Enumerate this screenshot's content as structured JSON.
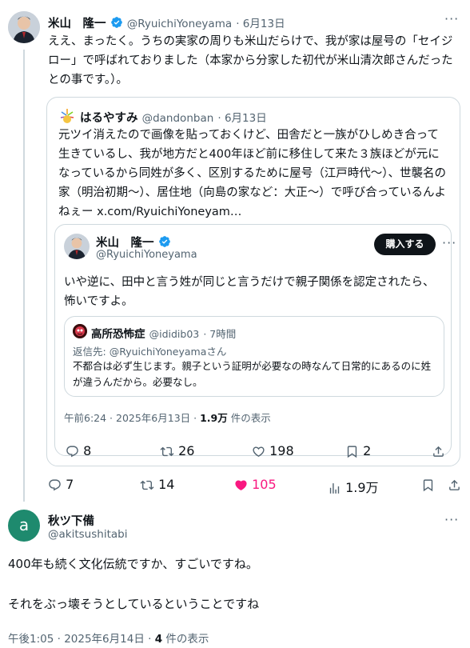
{
  "tweet1": {
    "name": "米山　隆一",
    "handle": "@RyuichiYoneyama",
    "date": "· 6月13日",
    "text": "ええ、まったく。うちの実家の周りも米山だらけで、我が家は屋号の「セイジロー」で呼ばれておりました（本家から分家した初代が米山清次郎さんだったとの事です。）。",
    "replies": "7",
    "reposts": "14",
    "likes": "105",
    "views": "1.9万"
  },
  "quote1": {
    "name": "はるやすみ",
    "handle": "@dandonban",
    "date": "· 6月13日",
    "text": "元ツイ消えたので画像を貼っておくけど、田舎だと一族がひしめき合って生きているし、我が地方だと400年ほど前に移住して来た３族ほどが元になっているから同姓が多く、区別するために屋号（江戸時代～）、世襲名の家（明治初期～）、居住地（向島の家など：大正～）で呼び合っているんよねぇー ",
    "link": "x.com/RyuichiYoneyam…"
  },
  "quote2": {
    "name": "米山　隆一",
    "handle": "@RyuichiYoneyama",
    "buy_label": "購入する",
    "text": "いや逆に、田中と言う姓が同じと言うだけで親子関係を認定されたら、怖いですよ。",
    "timestamp": "午前6:24 · 2025年6月13日 · ",
    "views_count": "1.9万",
    "views_label": " 件の表示",
    "replies": "8",
    "reposts": "26",
    "likes": "198",
    "bookmarks": "2"
  },
  "quote3": {
    "name": "高所恐怖症",
    "handle": "@ididib03",
    "date": "· 7時間",
    "reply_to_prefix": "返信先: ",
    "reply_to_handle": "@RyuichiYoneyama",
    "reply_to_suffix": "さん",
    "text": "不都合は必ず生じます。親子という証明が必要なの時なんて日常的にあるのに姓が違うんだから。必要なし。"
  },
  "reply": {
    "avatar_letter": "a",
    "avatar_color": "#1e8a6e",
    "name": "秋ツ下備",
    "handle": "@akitsushitabi",
    "line1": "400年も続く文化伝統ですか、すごいですね。",
    "line2": "それをぶっ壊そうとしているということですね",
    "timestamp": "午後1:05 · 2025年6月14日 · ",
    "views_count": "4",
    "views_label": " 件の表示"
  },
  "colors": {
    "accent": "#1d9bf0",
    "like": "#f91880",
    "text": "#0f1419",
    "muted": "#536471",
    "border": "#cfd9de"
  }
}
